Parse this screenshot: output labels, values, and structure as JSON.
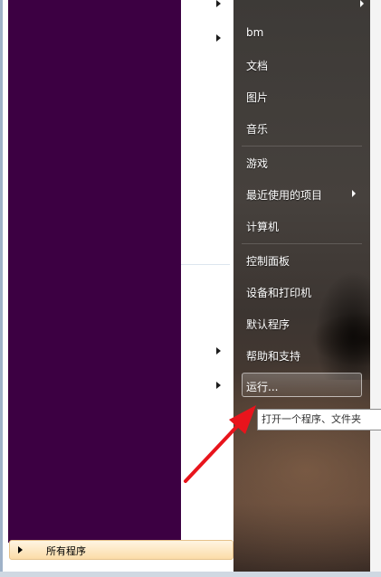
{
  "start_menu": {
    "all_programs_label": "所有程序",
    "places": [
      {
        "label": "bm"
      },
      {
        "label": "文档"
      },
      {
        "label": "图片"
      },
      {
        "label": "音乐"
      },
      {
        "label": "游戏"
      },
      {
        "label": "最近使用的项目"
      },
      {
        "label": "计算机"
      },
      {
        "label": "控制面板"
      },
      {
        "label": "设备和打印机"
      },
      {
        "label": "默认程序"
      },
      {
        "label": "帮助和支持"
      }
    ],
    "run_label": "运行...",
    "run_tooltip": "打开一个程序、文件夹"
  },
  "colors": {
    "redacted": "#3c0042",
    "annotation_arrow": "#e8141c"
  }
}
